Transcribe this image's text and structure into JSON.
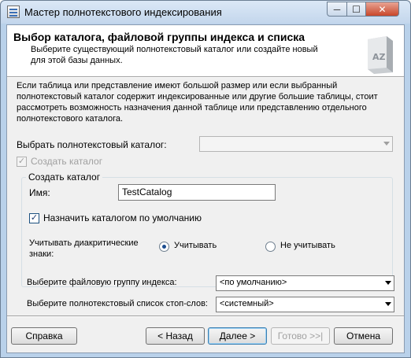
{
  "window": {
    "title": "Мастер полнотекстового индексирования",
    "controls": {
      "minimize": "─",
      "maximize": "☐",
      "close": "✕"
    }
  },
  "header": {
    "title": "Выбор каталога, файловой группы индекса и списка",
    "subtitle": "Выберите существующий полнотекстовый каталог или создайте новый для этой базы данных.",
    "image_text": "AZ"
  },
  "description": "Если таблица или представление имеют большой размер или если выбранный полнотекстовый каталог содержит индексированные или другие большие таблицы, стоит рассмотреть возможность назначения данной таблице или представлению отдельного полнотекстового каталога.",
  "catalog_select": {
    "label": "Выбрать полнотекстовый каталог:",
    "value": ""
  },
  "create_catalog_checkbox": {
    "label": "Создать каталог",
    "checked": true,
    "disabled": true
  },
  "create_group": {
    "title": "Создать каталог",
    "name_label": "Имя:",
    "name_value": "TestCatalog",
    "default_checkbox_label": "Назначить каталогом по умолчанию",
    "default_checked": true,
    "accent_label": "Учитывать диакритические знаки:",
    "accent_options": [
      {
        "label": "Учитывать",
        "selected": true
      },
      {
        "label": "Не учитывать",
        "selected": false
      }
    ]
  },
  "filegroup_select": {
    "label": "Выберите файловую группу индекса:",
    "value": "<по умолчанию>"
  },
  "stoplist_select": {
    "label": "Выберите полнотекстовый список стоп-слов:",
    "value": "<системный>"
  },
  "buttons": {
    "help": "Справка",
    "back": "< Назад",
    "next": "Далее >",
    "finish": "Готово >>|",
    "cancel": "Отмена"
  }
}
